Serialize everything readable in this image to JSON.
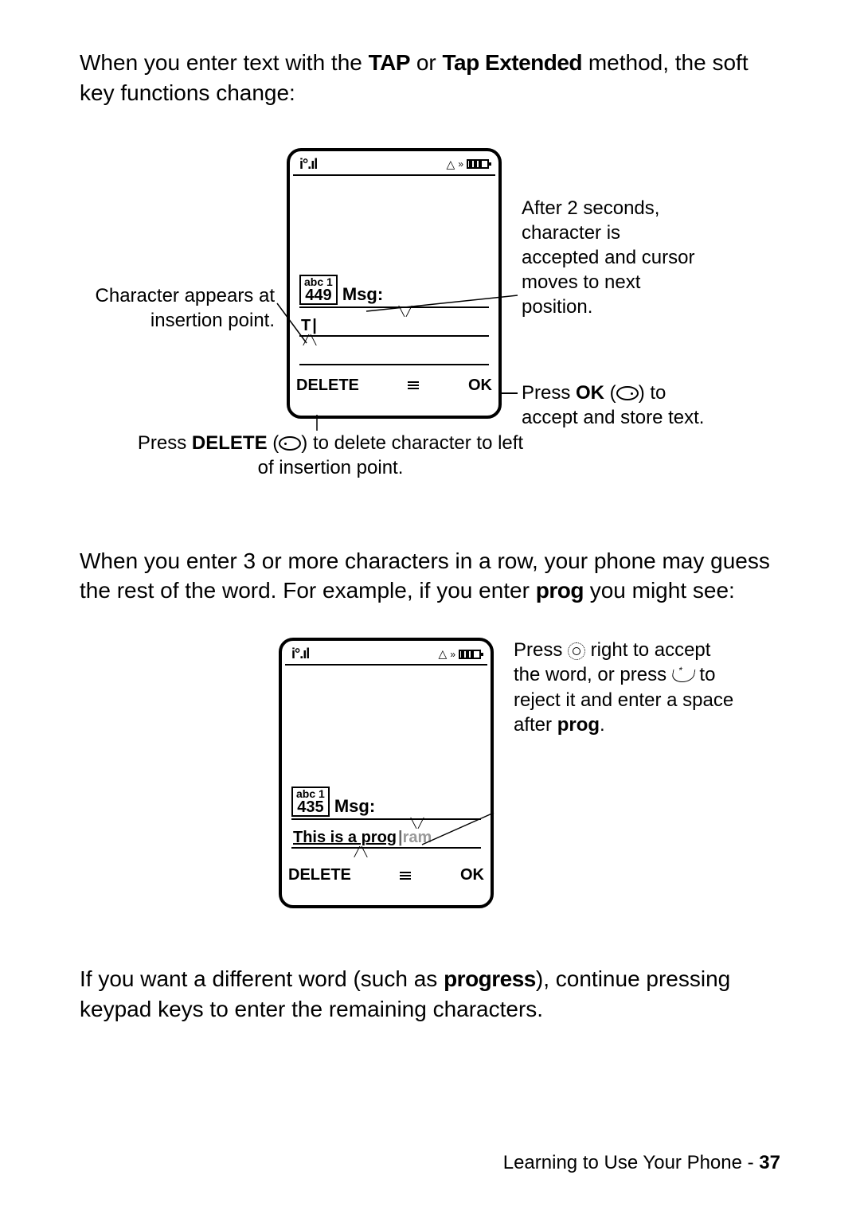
{
  "intro1_a": "When you enter text with the ",
  "intro1_b": " or ",
  "intro1_c": " method, the soft key functions change:",
  "tap": "TAP",
  "tap_ext": "Tap Extended",
  "screen1": {
    "mode_label": "abc 1",
    "count": "449",
    "msg_label": "Msg:",
    "typed": "T",
    "delete": "DELETE",
    "ok": "OK"
  },
  "callouts1": {
    "left_top": "Character appears at insertion point.",
    "right_top": "After 2 seconds, character is accepted and cursor moves to next position.",
    "right_bottom_a": "Press ",
    "right_bottom_b": " (",
    "right_bottom_c": ") to accept and store text.",
    "right_bottom_ok": "OK",
    "below_a": "Press ",
    "below_b": " (",
    "below_c": ") to delete character to left of insertion point.",
    "below_delete": "DELETE"
  },
  "intro2_a": "When you enter 3 or more characters in a row, your phone may guess the rest of the word. For example, if you enter ",
  "intro2_b": " you might see:",
  "prog": "prog",
  "screen2": {
    "mode_label": "abc 1",
    "count": "435",
    "msg_label": "Msg:",
    "typed": "This is a prog",
    "suggest": " ram",
    "delete": "DELETE",
    "ok": "OK"
  },
  "callouts2": {
    "a": "Press ",
    "b": " right to accept the word, or press ",
    "c": " to reject it and enter a space after ",
    "d": ".",
    "prog": "prog"
  },
  "outro_a": "If you want a different word (such as ",
  "outro_b": "), continue pressing keypad keys to enter the remaining characters.",
  "progress": "progress",
  "footer_text": "Learning to Use Your Phone - ",
  "page_num": "37"
}
